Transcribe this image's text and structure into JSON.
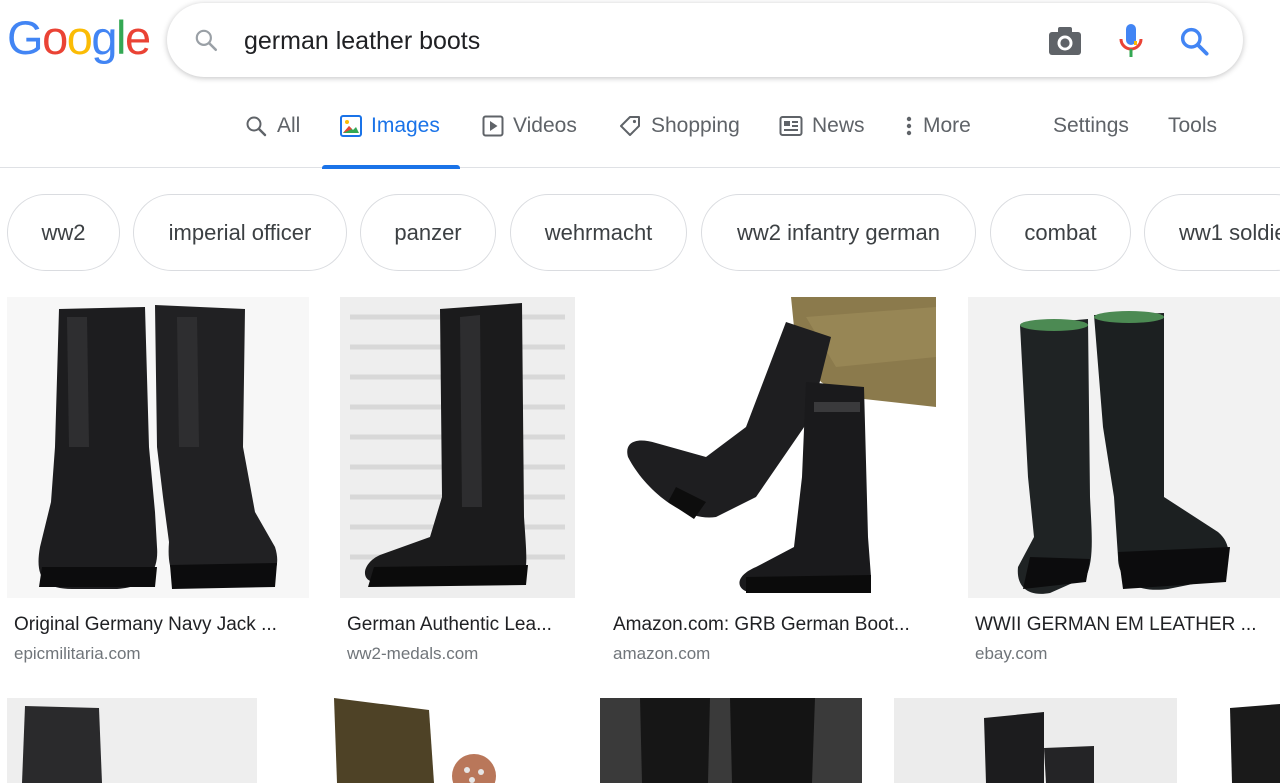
{
  "logo": {
    "letters": [
      "G",
      "o",
      "o",
      "g",
      "l",
      "e"
    ],
    "colors": [
      "#4285F4",
      "#EA4335",
      "#FBBC05",
      "#4285F4",
      "#34A853",
      "#EA4335"
    ]
  },
  "search": {
    "query": "german leather boots"
  },
  "tabs": [
    {
      "label": "All",
      "icon": "search-icon"
    },
    {
      "label": "Images",
      "icon": "image-icon",
      "active": true
    },
    {
      "label": "Videos",
      "icon": "play-icon"
    },
    {
      "label": "Shopping",
      "icon": "tag-icon"
    },
    {
      "label": "News",
      "icon": "newspaper-icon"
    },
    {
      "label": "More",
      "icon": "more-vert-icon"
    }
  ],
  "tools": {
    "settings": "Settings",
    "tools": "Tools"
  },
  "chips": [
    "ww2",
    "imperial officer",
    "panzer",
    "wehrmacht",
    "ww2 infantry german",
    "combat",
    "ww1 soldie"
  ],
  "results": [
    {
      "title": "Original Germany Navy Jack ...",
      "source": "epicmilitaria.com"
    },
    {
      "title": "German Authentic Lea...",
      "source": "ww2-medals.com"
    },
    {
      "title": "Amazon.com: GRB German Boot...",
      "source": "amazon.com"
    },
    {
      "title": "WWII GERMAN EM LEATHER ...",
      "source": "ebay.com"
    }
  ],
  "colors": {
    "accent": "#1a73e8",
    "muted": "#5f6368",
    "source": "#70757a"
  }
}
